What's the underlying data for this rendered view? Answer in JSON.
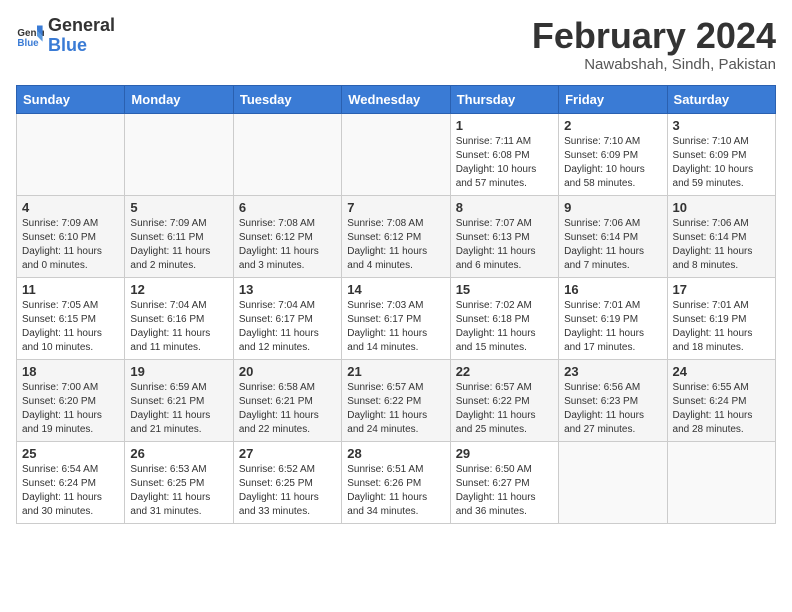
{
  "logo": {
    "general": "General",
    "blue": "Blue"
  },
  "header": {
    "title": "February 2024",
    "subtitle": "Nawabshah, Sindh, Pakistan"
  },
  "days": [
    "Sunday",
    "Monday",
    "Tuesday",
    "Wednesday",
    "Thursday",
    "Friday",
    "Saturday"
  ],
  "weeks": [
    [
      {
        "day": "",
        "info": ""
      },
      {
        "day": "",
        "info": ""
      },
      {
        "day": "",
        "info": ""
      },
      {
        "day": "",
        "info": ""
      },
      {
        "day": "1",
        "info": "Sunrise: 7:11 AM\nSunset: 6:08 PM\nDaylight: 10 hours and 57 minutes."
      },
      {
        "day": "2",
        "info": "Sunrise: 7:10 AM\nSunset: 6:09 PM\nDaylight: 10 hours and 58 minutes."
      },
      {
        "day": "3",
        "info": "Sunrise: 7:10 AM\nSunset: 6:09 PM\nDaylight: 10 hours and 59 minutes."
      }
    ],
    [
      {
        "day": "4",
        "info": "Sunrise: 7:09 AM\nSunset: 6:10 PM\nDaylight: 11 hours and 0 minutes."
      },
      {
        "day": "5",
        "info": "Sunrise: 7:09 AM\nSunset: 6:11 PM\nDaylight: 11 hours and 2 minutes."
      },
      {
        "day": "6",
        "info": "Sunrise: 7:08 AM\nSunset: 6:12 PM\nDaylight: 11 hours and 3 minutes."
      },
      {
        "day": "7",
        "info": "Sunrise: 7:08 AM\nSunset: 6:12 PM\nDaylight: 11 hours and 4 minutes."
      },
      {
        "day": "8",
        "info": "Sunrise: 7:07 AM\nSunset: 6:13 PM\nDaylight: 11 hours and 6 minutes."
      },
      {
        "day": "9",
        "info": "Sunrise: 7:06 AM\nSunset: 6:14 PM\nDaylight: 11 hours and 7 minutes."
      },
      {
        "day": "10",
        "info": "Sunrise: 7:06 AM\nSunset: 6:14 PM\nDaylight: 11 hours and 8 minutes."
      }
    ],
    [
      {
        "day": "11",
        "info": "Sunrise: 7:05 AM\nSunset: 6:15 PM\nDaylight: 11 hours and 10 minutes."
      },
      {
        "day": "12",
        "info": "Sunrise: 7:04 AM\nSunset: 6:16 PM\nDaylight: 11 hours and 11 minutes."
      },
      {
        "day": "13",
        "info": "Sunrise: 7:04 AM\nSunset: 6:17 PM\nDaylight: 11 hours and 12 minutes."
      },
      {
        "day": "14",
        "info": "Sunrise: 7:03 AM\nSunset: 6:17 PM\nDaylight: 11 hours and 14 minutes."
      },
      {
        "day": "15",
        "info": "Sunrise: 7:02 AM\nSunset: 6:18 PM\nDaylight: 11 hours and 15 minutes."
      },
      {
        "day": "16",
        "info": "Sunrise: 7:01 AM\nSunset: 6:19 PM\nDaylight: 11 hours and 17 minutes."
      },
      {
        "day": "17",
        "info": "Sunrise: 7:01 AM\nSunset: 6:19 PM\nDaylight: 11 hours and 18 minutes."
      }
    ],
    [
      {
        "day": "18",
        "info": "Sunrise: 7:00 AM\nSunset: 6:20 PM\nDaylight: 11 hours and 19 minutes."
      },
      {
        "day": "19",
        "info": "Sunrise: 6:59 AM\nSunset: 6:21 PM\nDaylight: 11 hours and 21 minutes."
      },
      {
        "day": "20",
        "info": "Sunrise: 6:58 AM\nSunset: 6:21 PM\nDaylight: 11 hours and 22 minutes."
      },
      {
        "day": "21",
        "info": "Sunrise: 6:57 AM\nSunset: 6:22 PM\nDaylight: 11 hours and 24 minutes."
      },
      {
        "day": "22",
        "info": "Sunrise: 6:57 AM\nSunset: 6:22 PM\nDaylight: 11 hours and 25 minutes."
      },
      {
        "day": "23",
        "info": "Sunrise: 6:56 AM\nSunset: 6:23 PM\nDaylight: 11 hours and 27 minutes."
      },
      {
        "day": "24",
        "info": "Sunrise: 6:55 AM\nSunset: 6:24 PM\nDaylight: 11 hours and 28 minutes."
      }
    ],
    [
      {
        "day": "25",
        "info": "Sunrise: 6:54 AM\nSunset: 6:24 PM\nDaylight: 11 hours and 30 minutes."
      },
      {
        "day": "26",
        "info": "Sunrise: 6:53 AM\nSunset: 6:25 PM\nDaylight: 11 hours and 31 minutes."
      },
      {
        "day": "27",
        "info": "Sunrise: 6:52 AM\nSunset: 6:25 PM\nDaylight: 11 hours and 33 minutes."
      },
      {
        "day": "28",
        "info": "Sunrise: 6:51 AM\nSunset: 6:26 PM\nDaylight: 11 hours and 34 minutes."
      },
      {
        "day": "29",
        "info": "Sunrise: 6:50 AM\nSunset: 6:27 PM\nDaylight: 11 hours and 36 minutes."
      },
      {
        "day": "",
        "info": ""
      },
      {
        "day": "",
        "info": ""
      }
    ]
  ]
}
